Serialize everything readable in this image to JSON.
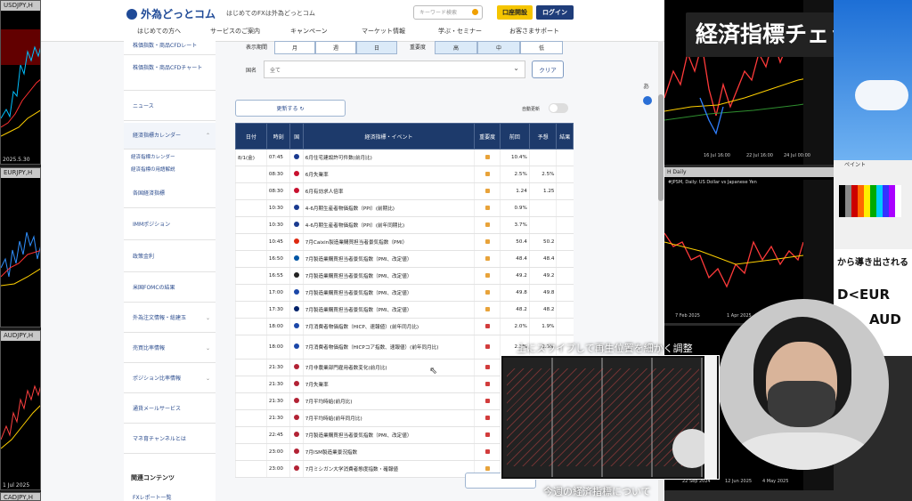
{
  "left_windows": [
    {
      "title": "USDJPY,H",
      "date": "2025.5.30"
    },
    {
      "title": "EURJPY,H",
      "date": ""
    },
    {
      "title": "AUDJPY,H",
      "date": "1 Jul 2025"
    },
    {
      "title": "CADJPY,H",
      "date": ""
    }
  ],
  "header": {
    "logo": "外為どっとコム",
    "tagline": "はじめてのFXは外為どっとコム",
    "search_placeholder": "キーワード検索",
    "open_account": "口座開設",
    "login": "ログイン",
    "nav": [
      "はじめての方へ",
      "サービスのご案内",
      "キャンペーン",
      "マーケット情報",
      "学ぶ・セミナー",
      "お客さまサポート"
    ]
  },
  "sidebar": {
    "items": [
      "株価指数・商品CFDレート",
      "株価指数・商品CFDチャート",
      "ニュース",
      "経済指標カレンダー",
      "各国経済指標",
      "IMMポジション",
      "政策金利",
      "米国FOMCの結果",
      "外為注文情報・総建玉",
      "売買比率情報",
      "ポジション比率情報",
      "通貨メールサービス",
      "マネ育チャンネルとは"
    ],
    "subitems": [
      "経済指標カレンダー",
      "経済指標の用語解説"
    ],
    "related": "関連コンテンツ",
    "related_first": "FXレポート一覧"
  },
  "filters": {
    "period_label": "表示期間",
    "periods": [
      "月",
      "週",
      "日"
    ],
    "importance_label": "重要度",
    "importance": [
      "高",
      "中",
      "低"
    ],
    "country_label": "国名",
    "country_value": "全て",
    "clear": "クリア",
    "refresh": "更新する",
    "auto_refresh": "自動更新"
  },
  "table": {
    "headers": [
      "日付",
      "時刻",
      "国",
      "経済指標・イベント",
      "重要度",
      "前回",
      "予想",
      "結果"
    ],
    "date": "8/1(金)",
    "rows": [
      {
        "time": "07:45",
        "flag": "#1a3a8f",
        "event": "6月住宅建設許可件数(前月比)",
        "imp": "#e8a33a",
        "prev": "10.4%",
        "fcst": ""
      },
      {
        "time": "08:30",
        "flag": "#c8102e",
        "event": "6月失業率",
        "imp": "#e8a33a",
        "prev": "2.5%",
        "fcst": "2.5%"
      },
      {
        "time": "08:30",
        "flag": "#c8102e",
        "event": "6月有効求人倍率",
        "imp": "#e8a33a",
        "prev": "1.24",
        "fcst": "1.25"
      },
      {
        "time": "10:30",
        "flag": "#1a3a8f",
        "event": "4-6月期生産者物価指数（PPI）(前期比)",
        "imp": "#e8a33a",
        "prev": "0.9%",
        "fcst": ""
      },
      {
        "time": "10:30",
        "flag": "#1a3a8f",
        "event": "4-6月期生産者物価指数（PPI）(前年同期比)",
        "imp": "#e8a33a",
        "prev": "3.7%",
        "fcst": ""
      },
      {
        "time": "10:45",
        "flag": "#de2910",
        "event": "7月Caixin製造業購買担当者景気指数（PMI）",
        "imp": "#e8a33a",
        "prev": "50.4",
        "fcst": "50.2"
      },
      {
        "time": "16:50",
        "flag": "#0055a4",
        "event": "7月製造業購買担当者景気指数（PMI、改定値）",
        "imp": "#e8a33a",
        "prev": "48.4",
        "fcst": "48.4"
      },
      {
        "time": "16:55",
        "flag": "#222222",
        "event": "7月製造業購買担当者景気指数（PMI、改定値）",
        "imp": "#e8a33a",
        "prev": "49.2",
        "fcst": "49.2"
      },
      {
        "time": "17:00",
        "flag": "#1b47a8",
        "event": "7月製造業購買担当者景気指数（PMI、改定値）",
        "imp": "#e8a33a",
        "prev": "49.8",
        "fcst": "49.8"
      },
      {
        "time": "17:30",
        "flag": "#012169",
        "event": "7月製造業購買担当者景気指数（PMI、改定値）",
        "imp": "#e8a33a",
        "prev": "48.2",
        "fcst": "48.2"
      },
      {
        "time": "18:00",
        "flag": "#1b47a8",
        "event": "7月消費者物価指数（HICP、速報値）(前年同月比)",
        "imp": "#d23c3c",
        "prev": "2.0%",
        "fcst": "1.9%"
      },
      {
        "time": "18:00",
        "flag": "#1b47a8",
        "event": "7月消費者物価指数（HICPコア指数、速報値）(前年同月比)",
        "imp": "#d23c3c",
        "prev": "2.3%",
        "fcst": "2.3%"
      },
      {
        "time": "21:30",
        "flag": "#b22234",
        "event": "7月非農業部門雇用者数変化(前月比)",
        "imp": "#d23c3c",
        "prev": "",
        "fcst": ""
      },
      {
        "time": "21:30",
        "flag": "#b22234",
        "event": "7月失業率",
        "imp": "#d23c3c",
        "prev": "",
        "fcst": ""
      },
      {
        "time": "21:30",
        "flag": "#b22234",
        "event": "7月平均時給(前月比)",
        "imp": "#d23c3c",
        "prev": "",
        "fcst": ""
      },
      {
        "time": "21:30",
        "flag": "#b22234",
        "event": "7月平均時給(前年同月比)",
        "imp": "#d23c3c",
        "prev": "",
        "fcst": ""
      },
      {
        "time": "22:45",
        "flag": "#b22234",
        "event": "7月製造業購買担当者景気指数（PMI、改定値）",
        "imp": "#d23c3c",
        "prev": "",
        "fcst": ""
      },
      {
        "time": "23:00",
        "flag": "#b22234",
        "event": "7月ISM製造業景況指数",
        "imp": "#d23c3c",
        "prev": "",
        "fcst": ""
      },
      {
        "time": "23:00",
        "flag": "#b22234",
        "event": "7月ミシガン大学消費者態度指数・確報値",
        "imp": "#e8a33a",
        "prev": "",
        "fcst": ""
      }
    ]
  },
  "overlay": {
    "title": "経済指標チェック",
    "caption_top": "上にスワイプして再生位置を細かく調整",
    "caption_bottom": "今週の経済指標について",
    "right_text1": "から導き出される",
    "right_text2": "D<EUR",
    "right_text3": "AUD",
    "paint_label": "ペイント",
    "chart_daily": "H Daily",
    "chart_daily_desc": "#JPSM, Daily: US Dollar vs Japanese Yen",
    "chart_dates": [
      "16 Jul 16:00",
      "22 Jul 16:00",
      "24 Jul 00:00"
    ],
    "chart_dates2": [
      "7 Feb 2025",
      "1 Apr 2025"
    ],
    "chart_dates3": [
      "22 Sep 2024",
      "12 Jun 2025",
      "4 May 2025"
    ]
  }
}
